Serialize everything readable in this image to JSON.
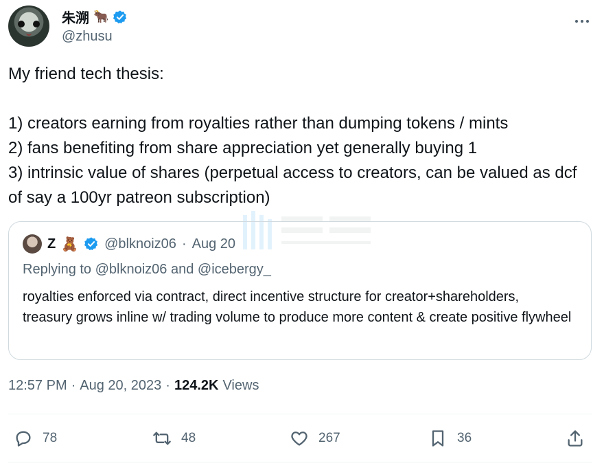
{
  "author": {
    "display_name": "朱溯",
    "badge_emoji": "🐂",
    "handle": "@zhusu",
    "verified": true
  },
  "tweet": {
    "text": "My friend tech thesis:\n\n1) creators earning from royalties rather than dumping tokens / mints\n2) fans benefiting from share appreciation yet generally buying 1\n3) intrinsic value of shares (perpetual access to creators, can be valued as dcf of say a 100yr patreon subscription)"
  },
  "quote": {
    "name": "Z",
    "emoji": "🧸",
    "handle": "@blknoiz06",
    "separator": "·",
    "date": "Aug 20",
    "replying_to": "Replying to @blknoiz06 and @icebergy_",
    "text": "royalties enforced via contract, direct incentive structure for creator+shareholders, treasury grows inline w/ trading volume to produce more content & create positive flywheel"
  },
  "meta": {
    "time": "12:57 PM",
    "date": "Aug 20, 2023",
    "separator": "·",
    "views_count": "124.2K",
    "views_label": "Views"
  },
  "actions": {
    "replies": "78",
    "retweets": "48",
    "likes": "267",
    "bookmarks": "36"
  },
  "colors": {
    "text": "#0f1419",
    "secondary": "#536471",
    "verified": "#1d9bf0",
    "border": "#cfd9de"
  }
}
